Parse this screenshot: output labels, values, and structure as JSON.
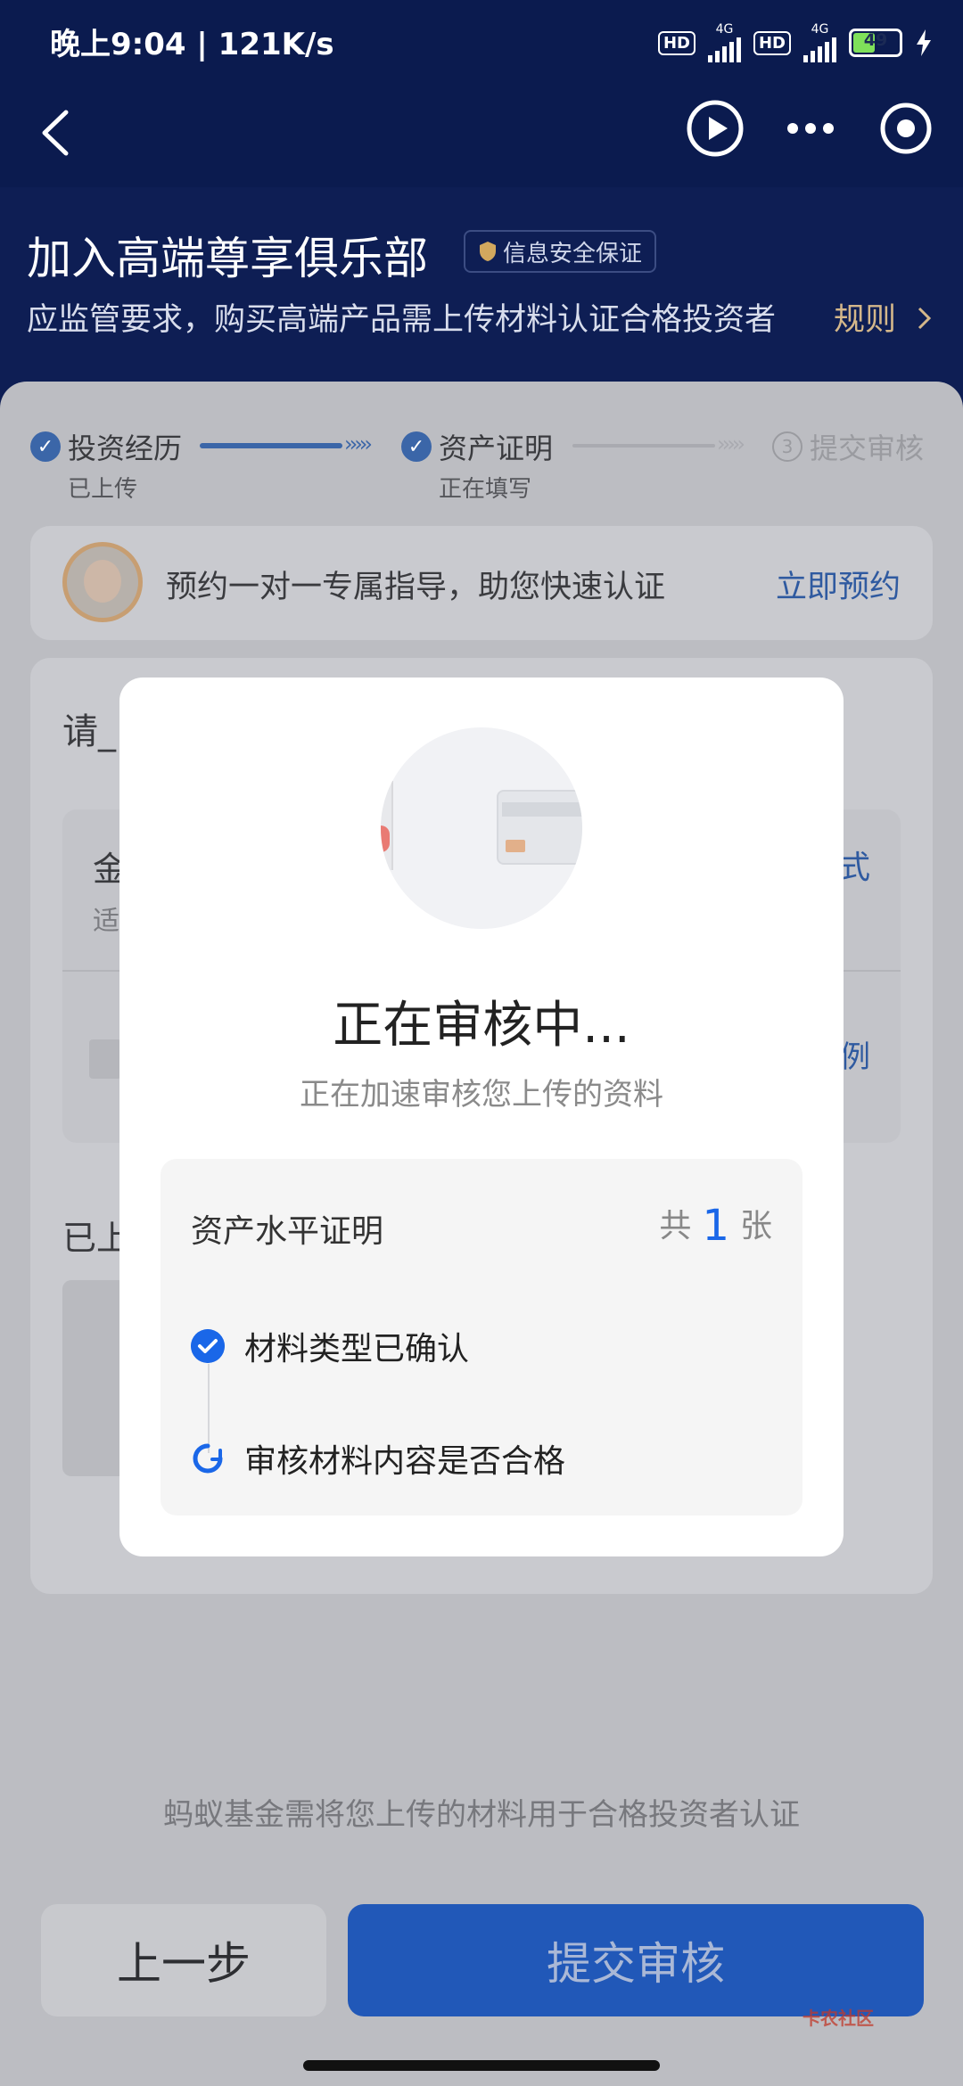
{
  "status_bar": {
    "time": "晚上9:04 | 121K/s",
    "hd1": "HD",
    "net1": "4G",
    "hd2": "HD",
    "net2": "4G",
    "battery": 49
  },
  "nav": {
    "back_icon": "chevron-left-icon",
    "play_icon": "play-icon",
    "more_icon": "more-icon",
    "target_icon": "target-icon"
  },
  "header": {
    "title": "加入高端尊享俱乐部",
    "badge": "信息安全保证",
    "subtitle": "应监管要求，购买高端产品需上传材料认证合格投资者",
    "rule_link": "规则"
  },
  "steps": [
    {
      "label": "投资经历",
      "status": "已上传"
    },
    {
      "label": "资产证明",
      "status": "正在填写"
    },
    {
      "label": "提交审核",
      "number": "3"
    }
  ],
  "guide": {
    "text": "预约一对一专属指导，助您快速认证",
    "action": "立即预约"
  },
  "background_fragments": {
    "please": "请_",
    "gold": "金",
    "fit": "适",
    "style": "式",
    "example": "例",
    "uploaded": "已上"
  },
  "modal": {
    "title": "正在审核中...",
    "subtitle": "正在加速审核您上传的资料",
    "doc_title": "资产水平证明",
    "count_prefix": "共",
    "count": "1",
    "count_unit": "张",
    "steps": [
      {
        "label": "材料类型已确认",
        "state": "done"
      },
      {
        "label": "审核材料内容是否合格",
        "state": "loading"
      }
    ]
  },
  "footer": {
    "notice": "蚂蚁基金需将您上传的材料用于合格投资者认证",
    "prev": "上一步",
    "submit": "提交审核",
    "watermark": "卡农社区"
  },
  "colors": {
    "header_bg": "#0e1e54",
    "accent_blue": "#1a67e8",
    "rule_gold": "#d4b78a"
  }
}
